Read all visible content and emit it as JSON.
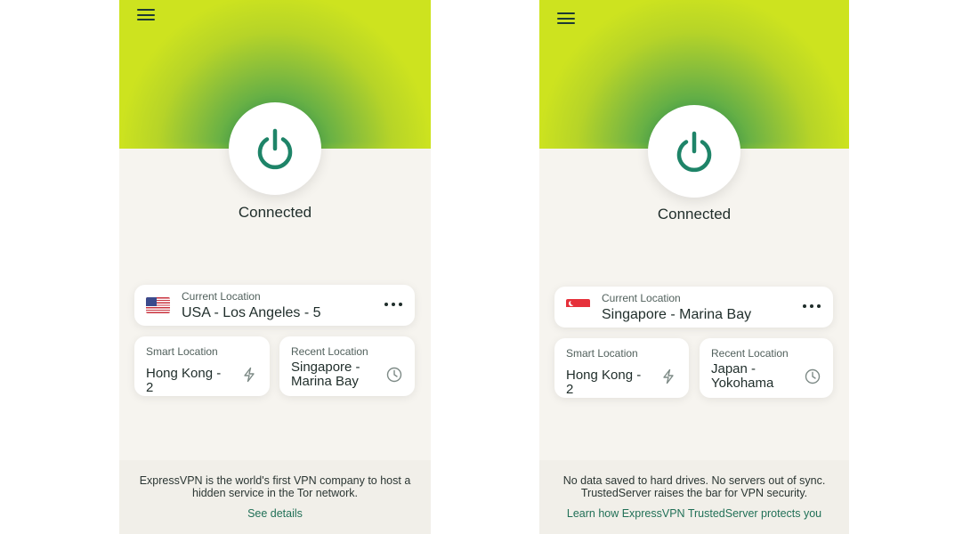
{
  "screens": [
    {
      "status": "Connected",
      "current_location": {
        "label": "Current Location",
        "value": "USA - Los Angeles - 5",
        "flag": "us-flag"
      },
      "smart_location": {
        "label": "Smart Location",
        "value": "Hong Kong - 2"
      },
      "recent_location": {
        "label": "Recent Location",
        "value": "Singapore - Marina Bay"
      },
      "footer": {
        "message": "ExpressVPN is the world's first VPN company to host a hidden service in the Tor network.",
        "link": "See details"
      }
    },
    {
      "status": "Connected",
      "current_location": {
        "label": "Current Location",
        "value": "Singapore - Marina Bay",
        "flag": "sg-flag"
      },
      "smart_location": {
        "label": "Smart Location",
        "value": "Hong Kong - 2"
      },
      "recent_location": {
        "label": "Recent Location",
        "value": "Japan - Yokohama"
      },
      "footer": {
        "message": "No data saved to hard drives. No servers out of sync. TrustedServer raises the bar for VPN security.",
        "link": "Learn how ExpressVPN TrustedServer protects you"
      }
    }
  ],
  "icons": {
    "menu": "hamburger-menu-icon",
    "power": "power-icon",
    "more": "more-horizontal-icon",
    "smart": "lightning-bolt-icon",
    "recent": "clock-icon"
  },
  "colors": {
    "accent_green": "#1e8468",
    "hero_light": "#cde31f",
    "hero_dark": "#2c9a57",
    "background": "#f6f4ef",
    "link": "#217057"
  }
}
